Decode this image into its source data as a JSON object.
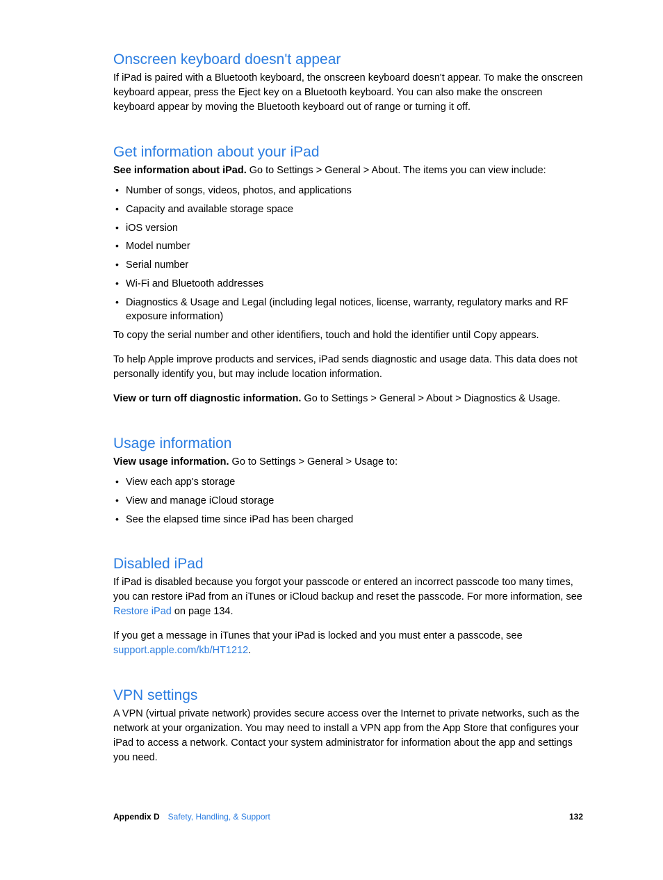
{
  "sections": {
    "s1": {
      "heading": "Onscreen keyboard doesn't appear",
      "body": "If iPad is paired with a Bluetooth keyboard, the onscreen keyboard doesn't appear. To make the onscreen keyboard appear, press the Eject key on a Bluetooth keyboard. You can also make the onscreen keyboard appear by moving the Bluetooth keyboard out of range or turning it off."
    },
    "s2": {
      "heading": "Get information about your iPad",
      "lead_strong": "See information about iPad.",
      "lead_rest": " Go to Settings > General > About. The items you can view include:",
      "items": [
        "Number of songs, videos, photos, and applications",
        "Capacity and available storage space",
        "iOS version",
        "Model number",
        "Serial number",
        "Wi-Fi and Bluetooth addresses",
        "Diagnostics & Usage and Legal (including legal notices, license, warranty, regulatory marks and RF exposure information)"
      ],
      "after1": "To copy the serial number and other identifiers, touch and hold the identifier until Copy appears.",
      "after2": "To help Apple improve products and services, iPad sends diagnostic and usage data. This data does not personally identify you, but may include location information.",
      "after3_strong": "View or turn off diagnostic information.",
      "after3_rest": " Go to Settings > General > About > Diagnostics & Usage."
    },
    "s3": {
      "heading": "Usage information",
      "lead_strong": "View usage information.",
      "lead_rest": " Go to Settings > General > Usage to:",
      "items": [
        "View each app's storage",
        "View and manage iCloud storage",
        "See the elapsed time since iPad has been charged"
      ]
    },
    "s4": {
      "heading": "Disabled iPad",
      "p1_pre": "If iPad is disabled because you forgot your passcode or entered an incorrect passcode too many times, you can restore iPad from an iTunes or iCloud backup and reset the passcode. For more information, see ",
      "p1_link": "Restore iPad",
      "p1_post": " on page 134.",
      "p2_pre": "If you get a message in iTunes that your iPad is locked and you must enter a passcode, see ",
      "p2_link": "support.apple.com/kb/HT1212",
      "p2_post": "."
    },
    "s5": {
      "heading": "VPN settings",
      "body": "A VPN (virtual private network) provides secure access over the Internet to private networks, such as the network at your organization. You may need to install a VPN app from the App Store that configures your iPad to access a network. Contact your system administrator for information about the app and settings you need."
    }
  },
  "footer": {
    "appendix": "Appendix D",
    "title": "Safety, Handling, & Support",
    "page": "132"
  }
}
